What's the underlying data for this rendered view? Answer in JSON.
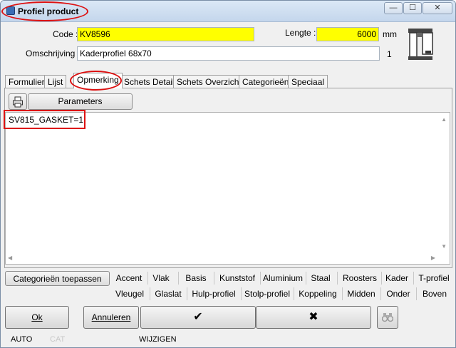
{
  "window": {
    "title": "Profiel product",
    "controls": {
      "minimize": "—",
      "maximize": "☐",
      "close": "✕"
    }
  },
  "form": {
    "code_label": "Code :",
    "code_value": "KV8596",
    "lengte_label": "Lengte :",
    "lengte_value": "6000",
    "lengte_unit": "mm",
    "omschrijving_label": "Omschrijving :",
    "omschrijving_value": "Kaderprofiel 68x70",
    "counter": "1"
  },
  "tabs": [
    {
      "label": "Formulier"
    },
    {
      "label": "Lijst"
    },
    {
      "label": "Opmerking"
    },
    {
      "label": "Schets Detail"
    },
    {
      "label": "Schets Overzicht"
    },
    {
      "label": "Categorieën"
    },
    {
      "label": "Speciaal"
    }
  ],
  "opmerking": {
    "print_icon": "printer-icon",
    "parameters_label": "Parameters",
    "text": "SV815_GASKET=1"
  },
  "categories": {
    "apply_label": "Categorieën toepassen",
    "row1": [
      "Accent",
      "Vlak",
      "Basis",
      "Kunststof",
      "Aluminium",
      "Staal",
      "Roosters",
      "Kader",
      "T-profiel"
    ],
    "row2": [
      "Vleugel",
      "Glaslat",
      "Hulp-profiel",
      "Stolp-profiel",
      "Koppeling",
      "Midden",
      "Onder",
      "Boven"
    ]
  },
  "buttons": {
    "ok": "Ok",
    "annuleren": "Annuleren",
    "confirm_icon": "✔",
    "cancel_icon": "✖",
    "search_icon": "binoculars-icon"
  },
  "status": {
    "mode": "AUTO",
    "cat": "CAT",
    "action": "WIJZIGEN"
  },
  "colors": {
    "highlight_yellow": "#ffff00",
    "annotation_red": "#dd1111"
  }
}
